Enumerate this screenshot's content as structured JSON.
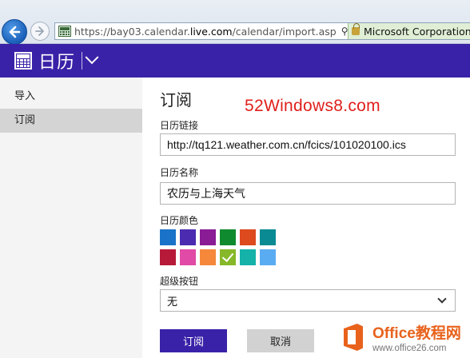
{
  "browser": {
    "url_prefix": "https://bay03.calendar.",
    "url_domain": "live.com",
    "url_path": "/calendar/import.asp",
    "certificate": "Microsoft Corporation",
    "search_symbol": "⚲",
    "refresh_symbol": "▾"
  },
  "app": {
    "title": "日历"
  },
  "sidebar": {
    "items": [
      {
        "label": "导入"
      },
      {
        "label": "订阅"
      }
    ]
  },
  "form": {
    "heading": "订阅",
    "watermark": "52Windows8.com",
    "link_label": "日历链接",
    "link_value": "http://tq121.weather.com.cn/fcics/101020100.ics",
    "name_label": "日历名称",
    "name_value": "农历与上海天气",
    "color_label": "日历颜色",
    "colors": [
      "#1a73c8",
      "#4b2bb0",
      "#8a1c96",
      "#108a2e",
      "#dd4a1e",
      "#0a8a92",
      "#b71a38",
      "#e14aa6",
      "#f5883b",
      "#86b829",
      "#14b2a8",
      "#5aacf2"
    ],
    "selected_color": "#86b829",
    "charms_label": "超级按钮",
    "charms_value": "无",
    "subscribe_label": "订阅",
    "cancel_label": "取消"
  },
  "logo": {
    "name": "Office教程网",
    "url": "www.office26.com"
  }
}
